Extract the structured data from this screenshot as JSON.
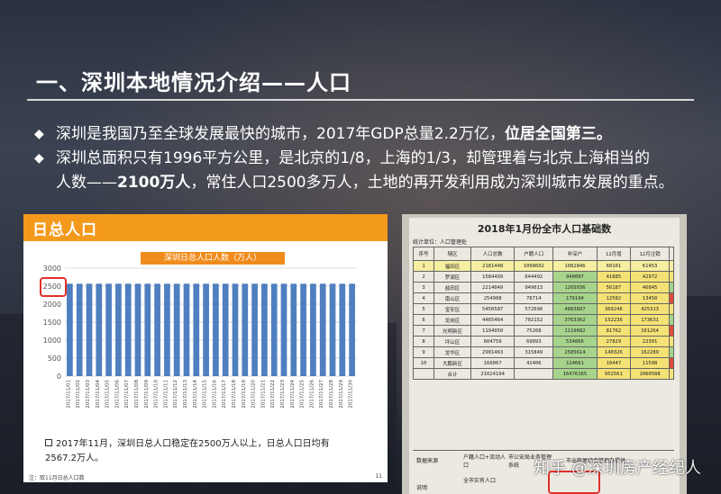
{
  "slide": {
    "title": "一、深圳本地情况介绍——人口",
    "bullets": [
      {
        "text": "深圳是我国乃至全球发展最快的城市，2017年GDP总量2.2万亿，",
        "strong": "位居全国第三。"
      },
      {
        "text": "深圳总面积只有1996平方公里，是北京的1/8，上海的1/3，却管理着与北京上海相当的"
      }
    ],
    "bullet2_cont_pre": "人数——",
    "bullet2_cont_strong": "2100万人",
    "bullet2_cont_post": "，常住人口2500多万人，土地的再开发利用成为深圳城市发展的重点。"
  },
  "left_panel": {
    "header": "日总人口",
    "chart_title": "深圳日总人口人数（万人）",
    "note": "2017年11月，深圳日总人口稳定在2500万人以上，日总人口日均有2567.2万人。",
    "footnote": "注：取11月日总人口数",
    "page_no": "11"
  },
  "chart_data": {
    "type": "bar",
    "title": "深圳日总人口人数（万人）",
    "ylim": [
      0,
      3000
    ],
    "yticks": [
      0,
      500,
      1000,
      1500,
      2000,
      2500,
      3000
    ],
    "categories": [
      "2017/11/01",
      "2017/11/02",
      "2017/11/03",
      "2017/11/04",
      "2017/11/05",
      "2017/11/06",
      "2017/11/07",
      "2017/11/08",
      "2017/11/09",
      "2017/11/10",
      "2017/11/11",
      "2017/11/12",
      "2017/11/13",
      "2017/11/14",
      "2017/11/15",
      "2017/11/16",
      "2017/11/17",
      "2017/11/18",
      "2017/11/19",
      "2017/11/20",
      "2017/11/21",
      "2017/11/22",
      "2017/11/23",
      "2017/11/24",
      "2017/11/25",
      "2017/11/26",
      "2017/11/27",
      "2017/11/28",
      "2017/11/29",
      "2017/11/30"
    ],
    "values": [
      2567,
      2567,
      2567,
      2567,
      2567,
      2567,
      2567,
      2567,
      2567,
      2567,
      2567,
      2567,
      2567,
      2567,
      2567,
      2567,
      2567,
      2567,
      2567,
      2567,
      2567,
      2567,
      2567,
      2567,
      2567,
      2567,
      2567,
      2567,
      2567,
      2567
    ],
    "bar_color": "#4f7fbf"
  },
  "right_panel": {
    "title": "2018年1月份全市人口基础数",
    "unit": "统计单位：人口管理处",
    "headers": [
      "序号",
      "辖区",
      "人口总数",
      "户籍人口",
      "非深户",
      "12月增",
      "12月注销",
      ""
    ],
    "rows": [
      [
        "1",
        "福田区",
        "2181448",
        "1098602",
        "1082846",
        "60101",
        "61453"
      ],
      [
        "2",
        "罗湖区",
        "1584499",
        "644492",
        "940007",
        "41885",
        "42972"
      ],
      [
        "3",
        "盐田区",
        "2214049",
        "949013",
        "1265036",
        "56187",
        "46845"
      ],
      [
        "4",
        "南山区",
        "254908",
        "78714",
        "176194",
        "12582",
        "13450"
      ],
      [
        "5",
        "宝安区",
        "5456587",
        "572690",
        "4883897",
        "369246",
        "425313"
      ],
      [
        "6",
        "龙岗区",
        "4465464",
        "702152",
        "3763362",
        "152236",
        "173631"
      ],
      [
        "7",
        "光明新区",
        "1194950",
        "75268",
        "1119682",
        "81762",
        "101264"
      ],
      [
        "8",
        "坪山区",
        "604759",
        "69893",
        "534866",
        "27829",
        "22301"
      ],
      [
        "9",
        "龙华区",
        "2901463",
        "315849",
        "2585614",
        "140326",
        "162289"
      ],
      [
        "10",
        "大鹏新区",
        "166067",
        "41406",
        "124661",
        "10447",
        "11508"
      ],
      [
        "",
        "合计",
        "21024194",
        "",
        "16476165",
        "952561",
        "1060588"
      ]
    ],
    "bottom_label_1": "数据来源",
    "bottom_label_2": "户籍人口+流动人口",
    "bottom_label_3": "市公安局业务管理系统",
    "bottom_label_4": "市出租屋综合管理办提供",
    "bottom_label_5": "全市实有人口",
    "bottom_label_6": "说明"
  },
  "watermark": "知乎 @深圳房产经纪人"
}
